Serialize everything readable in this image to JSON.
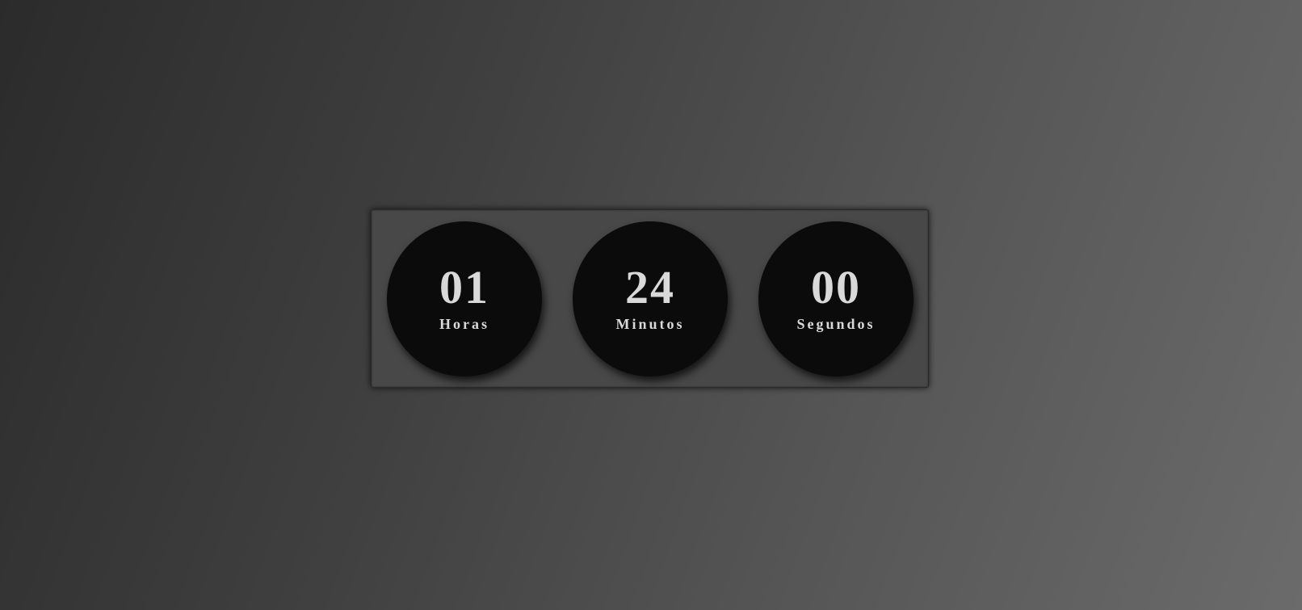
{
  "countdown": {
    "units": [
      {
        "value": "01",
        "label": "Horas"
      },
      {
        "value": "24",
        "label": "Minutos"
      },
      {
        "value": "00",
        "label": "Segundos"
      }
    ]
  },
  "colors": {
    "circle": "#0b0b0b",
    "panel": "#484848",
    "text": "#d9d9d9"
  }
}
